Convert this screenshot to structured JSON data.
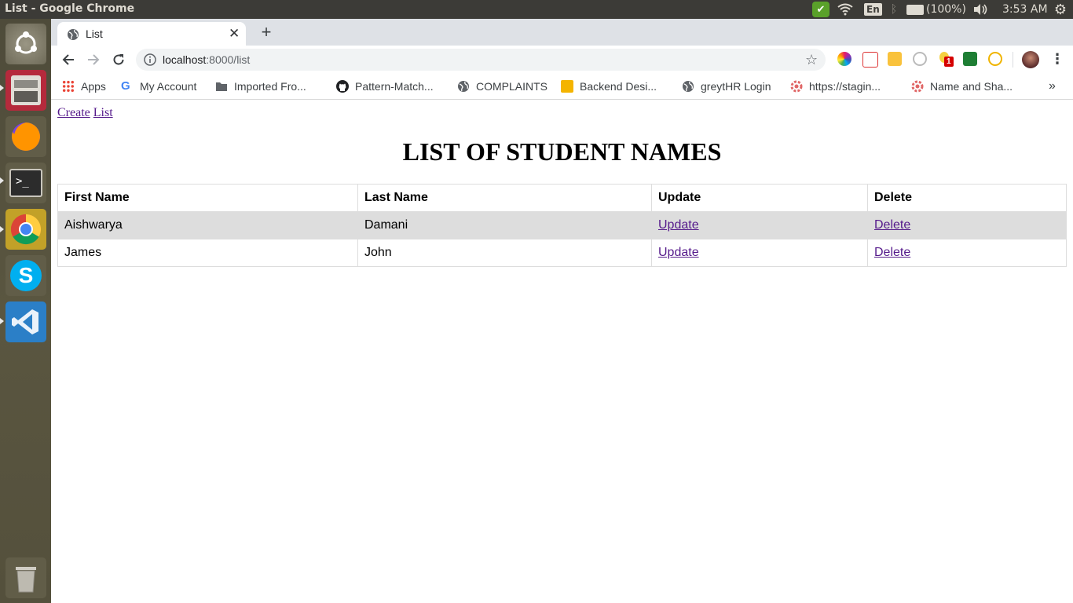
{
  "system": {
    "window_title": "List - Google Chrome",
    "keyboard": "En",
    "battery": "(100%)",
    "clock": "3:53 AM"
  },
  "browser": {
    "tab_title": "List",
    "url_host": "localhost",
    "url_rest": ":8000/list",
    "extension_badge": "1",
    "bookmarks": [
      {
        "label": "Apps",
        "icon": "apps-grid-icon"
      },
      {
        "label": "My Account",
        "icon": "google-icon"
      },
      {
        "label": "Imported Fro...",
        "icon": "folder-icon"
      },
      {
        "label": "Pattern-Match...",
        "icon": "github-icon"
      },
      {
        "label": "COMPLAINTS",
        "icon": "globe-icon"
      },
      {
        "label": "Backend Desi...",
        "icon": "slides-icon"
      },
      {
        "label": "greytHR Login",
        "icon": "globe-icon"
      },
      {
        "label": "https://stagin...",
        "icon": "gear-icon"
      },
      {
        "label": "Name and Sha...",
        "icon": "gear-icon"
      }
    ],
    "colors": {
      "tabstrip": "#dee1e6",
      "omnibox": "#f1f3f4"
    }
  },
  "page": {
    "nav": {
      "create": "Create",
      "list": "List"
    },
    "heading": "LIST OF STUDENT NAMES",
    "table": {
      "headers": [
        "First Name",
        "Last Name",
        "Update",
        "Delete"
      ],
      "rows": [
        {
          "first": "Aishwarya",
          "last": "Damani",
          "update": "Update",
          "delete": "Delete"
        },
        {
          "first": "James",
          "last": "John",
          "update": "Update",
          "delete": "Delete"
        }
      ]
    },
    "colors": {
      "link": "#551a8b",
      "row_alt": "#dddddd"
    }
  }
}
